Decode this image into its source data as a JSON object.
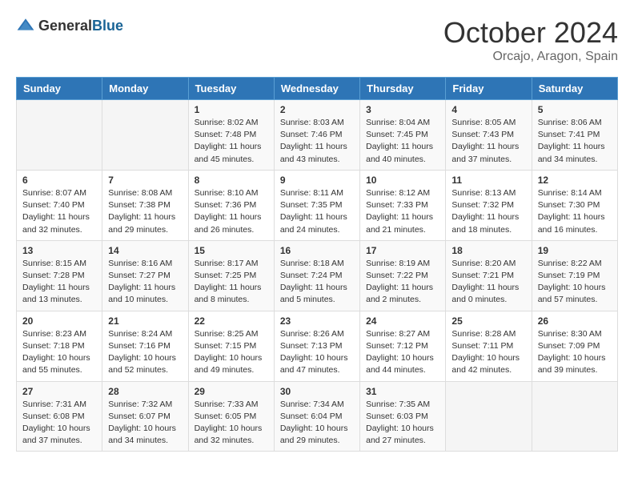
{
  "logo": {
    "general": "General",
    "blue": "Blue"
  },
  "header": {
    "month": "October 2024",
    "location": "Orcajo, Aragon, Spain"
  },
  "days_of_week": [
    "Sunday",
    "Monday",
    "Tuesday",
    "Wednesday",
    "Thursday",
    "Friday",
    "Saturday"
  ],
  "weeks": [
    [
      {
        "day": "",
        "info": ""
      },
      {
        "day": "",
        "info": ""
      },
      {
        "day": "1",
        "info": "Sunrise: 8:02 AM\nSunset: 7:48 PM\nDaylight: 11 hours and 45 minutes."
      },
      {
        "day": "2",
        "info": "Sunrise: 8:03 AM\nSunset: 7:46 PM\nDaylight: 11 hours and 43 minutes."
      },
      {
        "day": "3",
        "info": "Sunrise: 8:04 AM\nSunset: 7:45 PM\nDaylight: 11 hours and 40 minutes."
      },
      {
        "day": "4",
        "info": "Sunrise: 8:05 AM\nSunset: 7:43 PM\nDaylight: 11 hours and 37 minutes."
      },
      {
        "day": "5",
        "info": "Sunrise: 8:06 AM\nSunset: 7:41 PM\nDaylight: 11 hours and 34 minutes."
      }
    ],
    [
      {
        "day": "6",
        "info": "Sunrise: 8:07 AM\nSunset: 7:40 PM\nDaylight: 11 hours and 32 minutes."
      },
      {
        "day": "7",
        "info": "Sunrise: 8:08 AM\nSunset: 7:38 PM\nDaylight: 11 hours and 29 minutes."
      },
      {
        "day": "8",
        "info": "Sunrise: 8:10 AM\nSunset: 7:36 PM\nDaylight: 11 hours and 26 minutes."
      },
      {
        "day": "9",
        "info": "Sunrise: 8:11 AM\nSunset: 7:35 PM\nDaylight: 11 hours and 24 minutes."
      },
      {
        "day": "10",
        "info": "Sunrise: 8:12 AM\nSunset: 7:33 PM\nDaylight: 11 hours and 21 minutes."
      },
      {
        "day": "11",
        "info": "Sunrise: 8:13 AM\nSunset: 7:32 PM\nDaylight: 11 hours and 18 minutes."
      },
      {
        "day": "12",
        "info": "Sunrise: 8:14 AM\nSunset: 7:30 PM\nDaylight: 11 hours and 16 minutes."
      }
    ],
    [
      {
        "day": "13",
        "info": "Sunrise: 8:15 AM\nSunset: 7:28 PM\nDaylight: 11 hours and 13 minutes."
      },
      {
        "day": "14",
        "info": "Sunrise: 8:16 AM\nSunset: 7:27 PM\nDaylight: 11 hours and 10 minutes."
      },
      {
        "day": "15",
        "info": "Sunrise: 8:17 AM\nSunset: 7:25 PM\nDaylight: 11 hours and 8 minutes."
      },
      {
        "day": "16",
        "info": "Sunrise: 8:18 AM\nSunset: 7:24 PM\nDaylight: 11 hours and 5 minutes."
      },
      {
        "day": "17",
        "info": "Sunrise: 8:19 AM\nSunset: 7:22 PM\nDaylight: 11 hours and 2 minutes."
      },
      {
        "day": "18",
        "info": "Sunrise: 8:20 AM\nSunset: 7:21 PM\nDaylight: 11 hours and 0 minutes."
      },
      {
        "day": "19",
        "info": "Sunrise: 8:22 AM\nSunset: 7:19 PM\nDaylight: 10 hours and 57 minutes."
      }
    ],
    [
      {
        "day": "20",
        "info": "Sunrise: 8:23 AM\nSunset: 7:18 PM\nDaylight: 10 hours and 55 minutes."
      },
      {
        "day": "21",
        "info": "Sunrise: 8:24 AM\nSunset: 7:16 PM\nDaylight: 10 hours and 52 minutes."
      },
      {
        "day": "22",
        "info": "Sunrise: 8:25 AM\nSunset: 7:15 PM\nDaylight: 10 hours and 49 minutes."
      },
      {
        "day": "23",
        "info": "Sunrise: 8:26 AM\nSunset: 7:13 PM\nDaylight: 10 hours and 47 minutes."
      },
      {
        "day": "24",
        "info": "Sunrise: 8:27 AM\nSunset: 7:12 PM\nDaylight: 10 hours and 44 minutes."
      },
      {
        "day": "25",
        "info": "Sunrise: 8:28 AM\nSunset: 7:11 PM\nDaylight: 10 hours and 42 minutes."
      },
      {
        "day": "26",
        "info": "Sunrise: 8:30 AM\nSunset: 7:09 PM\nDaylight: 10 hours and 39 minutes."
      }
    ],
    [
      {
        "day": "27",
        "info": "Sunrise: 7:31 AM\nSunset: 6:08 PM\nDaylight: 10 hours and 37 minutes."
      },
      {
        "day": "28",
        "info": "Sunrise: 7:32 AM\nSunset: 6:07 PM\nDaylight: 10 hours and 34 minutes."
      },
      {
        "day": "29",
        "info": "Sunrise: 7:33 AM\nSunset: 6:05 PM\nDaylight: 10 hours and 32 minutes."
      },
      {
        "day": "30",
        "info": "Sunrise: 7:34 AM\nSunset: 6:04 PM\nDaylight: 10 hours and 29 minutes."
      },
      {
        "day": "31",
        "info": "Sunrise: 7:35 AM\nSunset: 6:03 PM\nDaylight: 10 hours and 27 minutes."
      },
      {
        "day": "",
        "info": ""
      },
      {
        "day": "",
        "info": ""
      }
    ]
  ]
}
